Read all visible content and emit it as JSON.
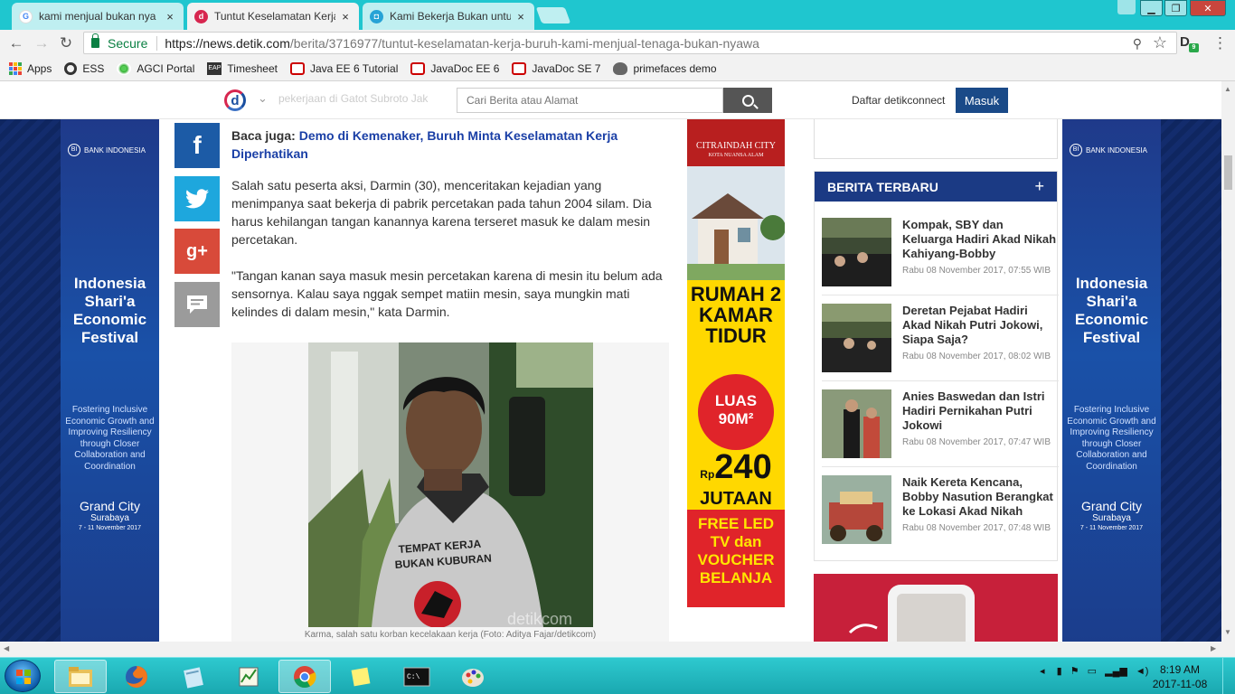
{
  "browser": {
    "tabs": [
      {
        "label": "kami menjual bukan nya",
        "favicon": "google-icon",
        "active": false
      },
      {
        "label": "Tuntut Keselamatan Kerja",
        "favicon": "detik-icon",
        "active": true
      },
      {
        "label": "Kami Bekerja Bukan untu",
        "favicon": "web-icon",
        "active": false
      }
    ],
    "secure_label": "Secure",
    "url_host": "https://news.detik.com",
    "url_path": "/berita/3716977/tuntut-keselamatan-kerja-buruh-kami-menjual-tenaga-bukan-nyawa",
    "extension_badge": "9",
    "bookmarks": [
      "Apps",
      "ESS",
      "AGCI Portal",
      "Timesheet",
      "Java EE 6 Tutorial",
      "JavaDoc EE 6",
      "JavaDoc SE 7",
      "primefaces demo"
    ]
  },
  "site": {
    "header_faded_text": "pekerjaan di Gatot Subroto Jak",
    "search_placeholder": "Cari Berita atau Alamat",
    "register_link": "Daftar detikconnect",
    "login_button": "Masuk"
  },
  "article": {
    "baca_juga_label": "Baca juga:",
    "baca_juga_link": "Demo di Kemenaker, Buruh Minta Keselamatan Kerja Diperhatikan",
    "paragraphs": [
      "Salah satu peserta aksi, Darmin (30), menceritakan kejadian yang menimpanya saat bekerja di pabrik percetakan pada tahun 2004 silam. Dia harus kehilangan tangan kanannya karena terseret masuk ke dalam mesin percetakan.",
      "\"Tangan kanan saya masuk mesin percetakan karena di mesin itu belum ada sensornya. Kalau saya nggak sempet matiin mesin, saya mungkin mati kelindes di dalam mesin,\" kata Darmin."
    ],
    "photo_shirt_text": "TEMPAT KERJA BUKAN KUBURAN",
    "photo_watermark": "detikcom",
    "photo_caption": "Karma, salah satu korban kecelakaan kerja (Foto: Aditya Fajar/detikcom)"
  },
  "banner": {
    "bank": "BANK INDONESIA",
    "title": "Indonesia Shari'a Economic Festival",
    "subtitle": "Fostering Inclusive Economic Growth and Improving Resiliency through Closer Collaboration and Coordination",
    "city": "Grand City",
    "city_sub": "Surabaya",
    "dates": "7 - 11 November 2017"
  },
  "mid_ad": {
    "brand": "CITRAINDAH CITY",
    "brand_sub": "KOTA NUANSA ALAM",
    "headline": "RUMAH 2 KAMAR TIDUR",
    "luas": "LUAS 90M²",
    "price_prefix": "Rp",
    "price": "240",
    "price_unit": "JUTAAN",
    "offer": "FREE LED TV dan VOUCHER BELANJA"
  },
  "news_widget": {
    "title": "BERITA TERBARU",
    "plus": "+",
    "items": [
      {
        "title": "Kompak, SBY dan Keluarga Hadiri Akad Nikah Kahiyang-Bobby",
        "date": "Rabu 08 November 2017, 07:55 WIB"
      },
      {
        "title": "Deretan Pejabat Hadiri Akad Nikah Putri Jokowi, Siapa Saja?",
        "date": "Rabu 08 November 2017, 08:02 WIB"
      },
      {
        "title": "Anies Baswedan dan Istri Hadiri Pernikahan Putri Jokowi",
        "date": "Rabu 08 November 2017, 07:47 WIB"
      },
      {
        "title": "Naik Kereta Kencana, Bobby Nasution Berangkat ke Lokasi Akad Nikah",
        "date": "Rabu 08 November 2017, 07:48 WIB"
      }
    ]
  },
  "taskbar": {
    "time": "8:19 AM",
    "date": "2017-11-08"
  },
  "colors": {
    "chrome_frame": "#1fc6cf",
    "detik_blue": "#1a4a88",
    "facebook": "#1c5ba6",
    "twitter": "#1ea7dd",
    "gplus": "#d84a3a"
  }
}
